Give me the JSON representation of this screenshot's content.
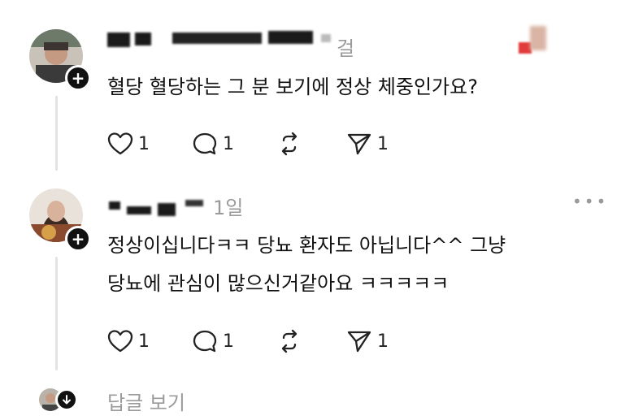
{
  "posts": [
    {
      "time_fragment": "걸",
      "text": "혈당 혈당하는 그 분 보기에 정상 체중인가요?",
      "likes": "1",
      "replies": "1",
      "shares": "1"
    },
    {
      "time_fragment": "1일",
      "more": "•••",
      "text_line1": "정상이십니다ㅋㅋ 당뇨 환자도 아닙니다^^ 그냥",
      "text_line2": "당뇨에 관심이 많으신거같아요 ㅋㅋㅋㅋㅋ",
      "likes": "1",
      "replies": "1",
      "shares": "1"
    }
  ],
  "view_replies_label": "답글 보기",
  "icons": {
    "like": "heart-icon",
    "reply": "comment-icon",
    "repost": "repost-icon",
    "share": "send-icon",
    "follow": "plus-icon",
    "expand": "arrow-down-icon"
  }
}
